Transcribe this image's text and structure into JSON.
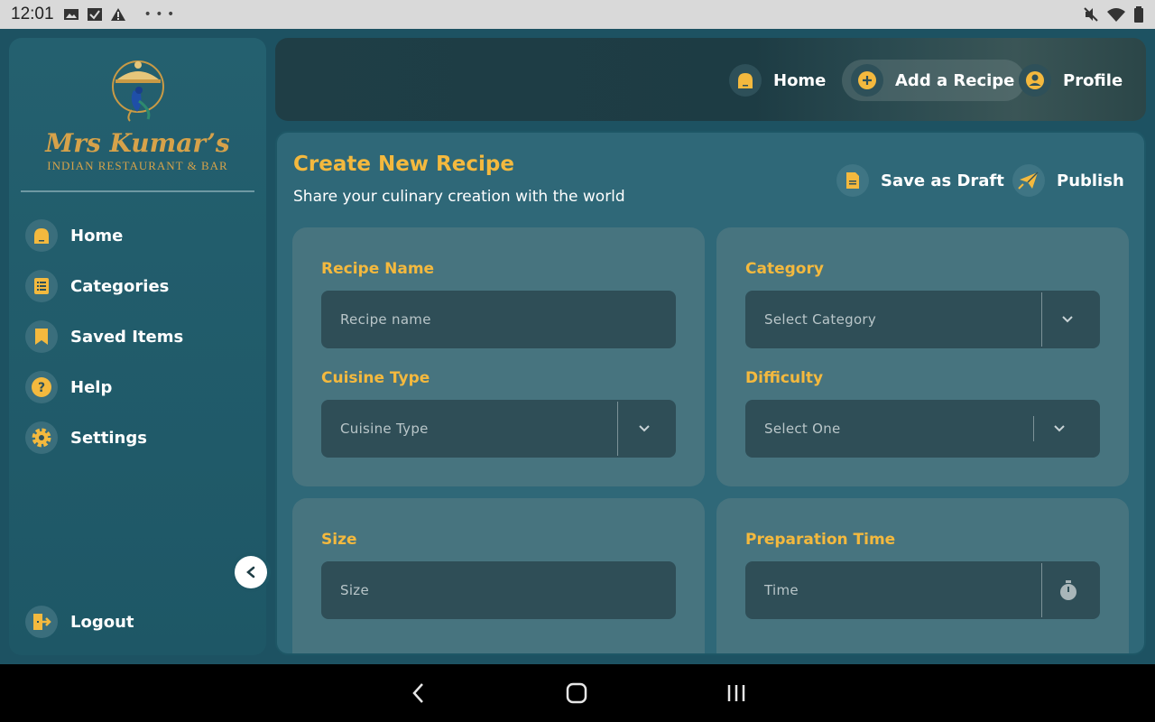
{
  "status_bar": {
    "time": "12:01"
  },
  "sidebar": {
    "brand_title": "Mrs Kumar’s",
    "brand_subtitle": "INDIAN RESTAURANT & BAR",
    "items": [
      {
        "label": "Home",
        "icon": "home-icon"
      },
      {
        "label": "Categories",
        "icon": "list-icon"
      },
      {
        "label": "Saved Items",
        "icon": "bookmark-icon"
      },
      {
        "label": "Help",
        "icon": "help-icon"
      },
      {
        "label": "Settings",
        "icon": "gear-icon"
      }
    ],
    "logout_label": "Logout"
  },
  "header": {
    "nav": [
      {
        "label": "Home",
        "icon": "home-icon",
        "active": false
      },
      {
        "label": "Add a Recipe",
        "icon": "plus-icon",
        "active": true
      },
      {
        "label": "Profile",
        "icon": "user-icon",
        "active": false
      }
    ]
  },
  "main": {
    "title": "Create New Recipe",
    "subtitle": "Share your culinary creation with the world",
    "save_draft_label": "Save as Draft",
    "publish_label": "Publish",
    "fields": {
      "recipe_name": {
        "label": "Recipe Name",
        "placeholder": "Recipe name"
      },
      "category": {
        "label": "Category",
        "placeholder": "Select Category"
      },
      "cuisine_type": {
        "label": "Cuisine Type",
        "placeholder": "Cuisine Type"
      },
      "difficulty": {
        "label": "Difficulty",
        "placeholder": "Select One"
      },
      "size": {
        "label": "Size",
        "placeholder": "Size"
      },
      "preparation_time": {
        "label": "Preparation Time",
        "placeholder": "Time"
      }
    }
  },
  "colors": {
    "accent": "#f4b93e",
    "background": "#1d5262",
    "panel": "#47747f",
    "field": "#2f4e57"
  }
}
